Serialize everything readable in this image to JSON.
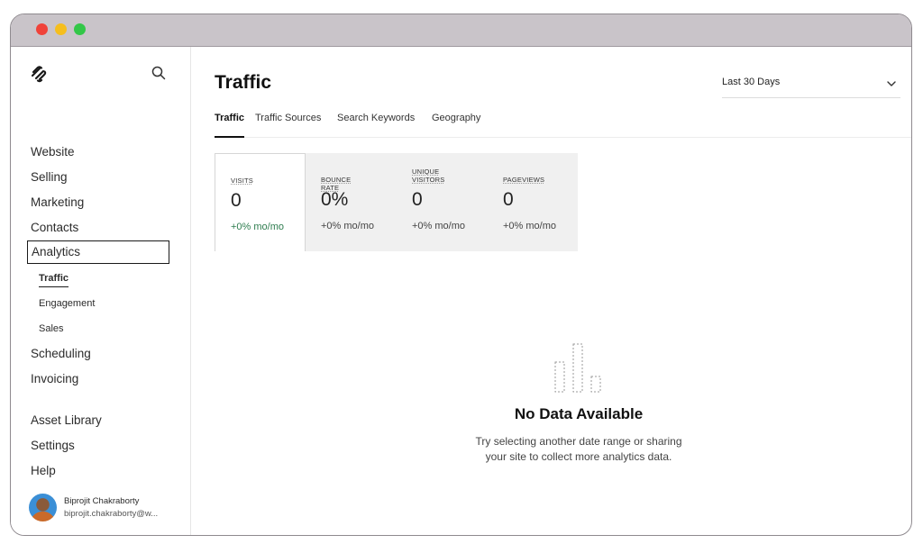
{
  "sidebar": {
    "nav": [
      {
        "label": "Website"
      },
      {
        "label": "Selling"
      },
      {
        "label": "Marketing"
      },
      {
        "label": "Contacts"
      },
      {
        "label": "Analytics"
      },
      {
        "label": "Scheduling"
      },
      {
        "label": "Invoicing"
      },
      {
        "label": "Asset Library"
      },
      {
        "label": "Settings"
      },
      {
        "label": "Help"
      }
    ],
    "sub_nav": [
      {
        "label": "Traffic"
      },
      {
        "label": "Engagement"
      },
      {
        "label": "Sales"
      }
    ],
    "profile": {
      "name": "Biprojit Chakraborty",
      "email": "biprojit.chakraborty@w..."
    }
  },
  "main": {
    "title": "Traffic",
    "date_range": "Last 30 Days",
    "tabs": [
      {
        "label": "Traffic"
      },
      {
        "label": "Traffic Sources"
      },
      {
        "label": "Search Keywords"
      },
      {
        "label": "Geography"
      }
    ],
    "metrics": [
      {
        "label": "VISITS",
        "value": "0",
        "change": "+0% mo/mo"
      },
      {
        "label": "BOUNCE RATE",
        "value": "0%",
        "change": "+0% mo/mo"
      },
      {
        "label": "UNIQUE VISITORS",
        "value": "0",
        "change": "+0% mo/mo"
      },
      {
        "label": "PAGEVIEWS",
        "value": "0",
        "change": "+0% mo/mo"
      }
    ],
    "empty_state": {
      "title": "No Data Available",
      "line1": "Try selecting another date range or sharing",
      "line2": "your site to collect more analytics data."
    }
  },
  "colors": {
    "positive_change": "#2e7d4f",
    "window_chrome": "#c9c4c9"
  }
}
